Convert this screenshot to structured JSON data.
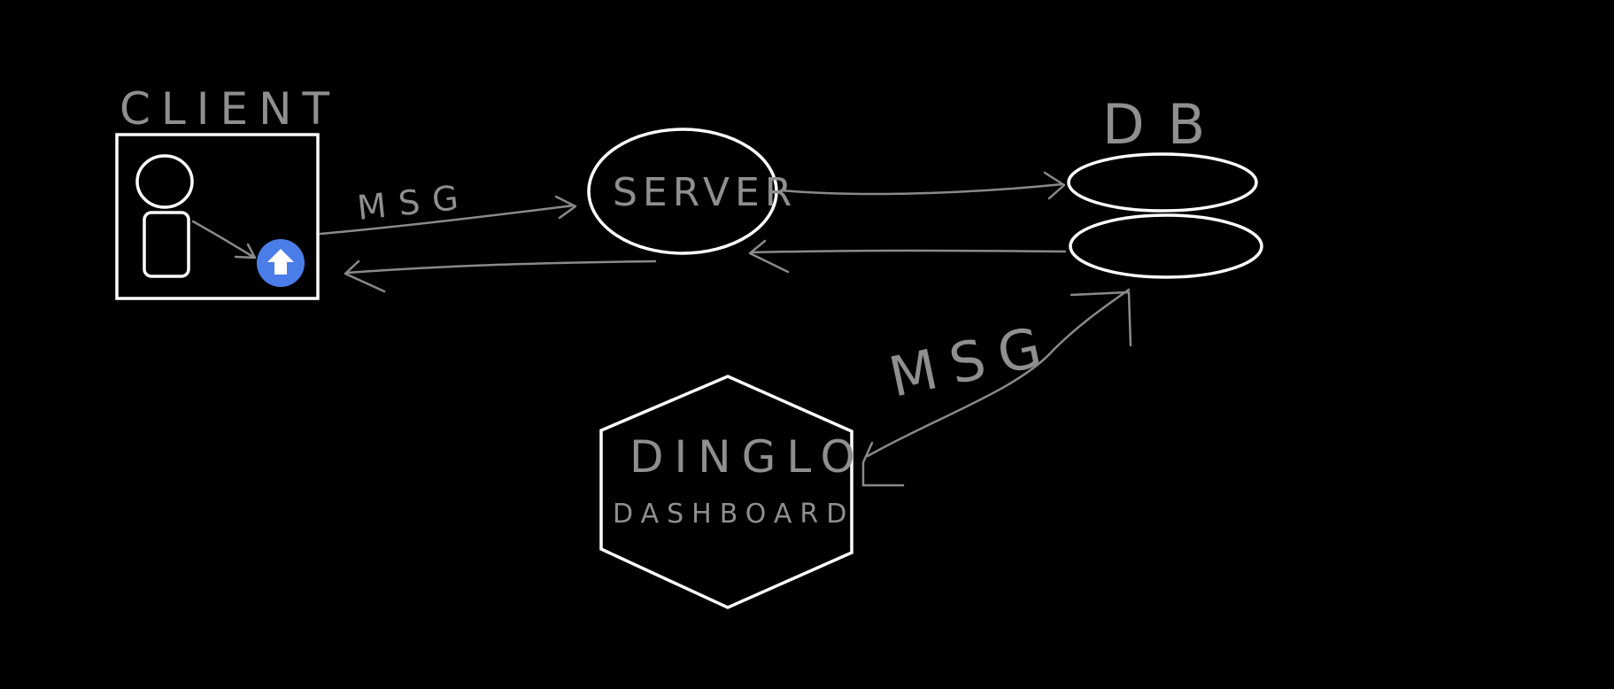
{
  "diagram": {
    "client": {
      "label": "CLIENT"
    },
    "server": {
      "label": "SERVER"
    },
    "db": {
      "label": "DB"
    },
    "dashboard": {
      "title": "DINGLO",
      "subtitle": "DASHBOARD"
    },
    "edges": {
      "client_to_server": {
        "label": "MSG"
      },
      "dashboard_to_db": {
        "label": "MSG"
      }
    },
    "colors": {
      "background": "#000000",
      "shape_stroke": "#ffffff",
      "arrow_stroke": "#8a8a8a",
      "text": "#8f8f8f",
      "upload_badge": "#4a7de8"
    },
    "icons": {
      "upload": "upload-arrow-icon",
      "user": "user-icon"
    }
  }
}
